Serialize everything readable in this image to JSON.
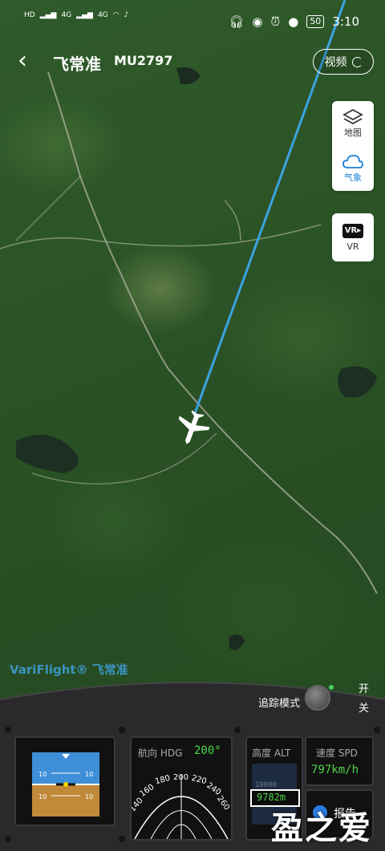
{
  "status_bar": {
    "left_indicators": [
      "HD",
      "4G",
      "4G"
    ],
    "battery": "50",
    "time": "3:10"
  },
  "header": {
    "back_icon": "chevron-left-icon",
    "brand": "飞常准",
    "flight_number": "MU2797",
    "video_label": "视频"
  },
  "side_panel": {
    "map_label": "地图",
    "weather_label": "气象",
    "vr_label": "VR"
  },
  "watermark": "VariFlight® 飞常准",
  "cockpit": {
    "track_mode_label": "追踪模式",
    "switch_on": "开",
    "switch_off": "关",
    "attitude_ticks": [
      "10",
      "10",
      "10",
      "10"
    ],
    "heading": {
      "title": "航向 HDG",
      "value": "200°",
      "dial_labels": [
        "140",
        "160",
        "180",
        "200",
        "220",
        "240",
        "260"
      ]
    },
    "altitude": {
      "title": "高度 ALT",
      "tape_top": "10000",
      "value": "9782m"
    },
    "speed": {
      "title": "速度 SPD",
      "value": "797km/h"
    },
    "report_label": "报告",
    "site_watermark": "盈之爱"
  },
  "colors": {
    "track_line": "#3aa3e0",
    "instrument_green": "#4fd54b",
    "sky_blue": "#3f8fd8",
    "ground_brown": "#c08a3a"
  }
}
